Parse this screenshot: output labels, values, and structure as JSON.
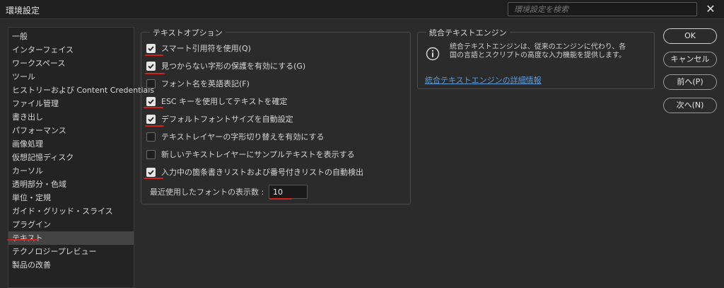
{
  "window": {
    "title": "環境設定",
    "search_placeholder": "環境設定を検索",
    "close_symbol": "✕"
  },
  "sidebar": {
    "items": [
      {
        "label": "一般"
      },
      {
        "label": "インターフェイス"
      },
      {
        "label": "ワークスペース"
      },
      {
        "label": "ツール"
      },
      {
        "label": "ヒストリーおよび Content Credentials"
      },
      {
        "label": "ファイル管理"
      },
      {
        "label": "書き出し"
      },
      {
        "label": "パフォーマンス"
      },
      {
        "label": "画像処理"
      },
      {
        "label": "仮想記憶ディスク"
      },
      {
        "label": "カーソル"
      },
      {
        "label": "透明部分・色域"
      },
      {
        "label": "単位・定規"
      },
      {
        "label": "ガイド・グリッド・スライス"
      },
      {
        "label": "プラグイン"
      },
      {
        "label": "テキスト",
        "selected": true
      },
      {
        "label": "テクノロジープレビュー"
      },
      {
        "label": "製品の改善"
      }
    ]
  },
  "text_options": {
    "title": "テキストオプション",
    "options": [
      {
        "label": "スマート引用符を使用(Q)",
        "checked": true
      },
      {
        "label": "見つからない字形の保護を有効にする(G)",
        "checked": true
      },
      {
        "label": "フォント名を英語表記(F)",
        "checked": false
      },
      {
        "label": "ESC キーを使用してテキストを確定",
        "checked": true
      },
      {
        "label": "デフォルトフォントサイズを自動設定",
        "checked": true
      },
      {
        "label": "テキストレイヤーの字形切り替えを有効にする",
        "checked": false
      },
      {
        "label": "新しいテキストレイヤーにサンプルテキストを表示する",
        "checked": false
      },
      {
        "label": "入力中の箇条書きリストおよび番号付きリストの自動検出",
        "checked": true
      }
    ],
    "recent_fonts_label": "最近使用したフォントの表示数 :",
    "recent_fonts_value": "10"
  },
  "engine": {
    "title": "統合テキストエンジン",
    "description": "統合テキストエンジンは、従来のエンジンに代わり、各国の言語とスクリプトの高度な入力機能を提供します。",
    "link": "統合テキストエンジンの詳細情報",
    "icon": "info-icon"
  },
  "buttons": {
    "ok": "OK",
    "cancel": "キャンセル",
    "prev": "前へ(P)",
    "next": "次へ(N)"
  },
  "colors": {
    "background": "#2b2b2b",
    "link": "#5e9bd8",
    "annotation": "#d41f1f"
  }
}
